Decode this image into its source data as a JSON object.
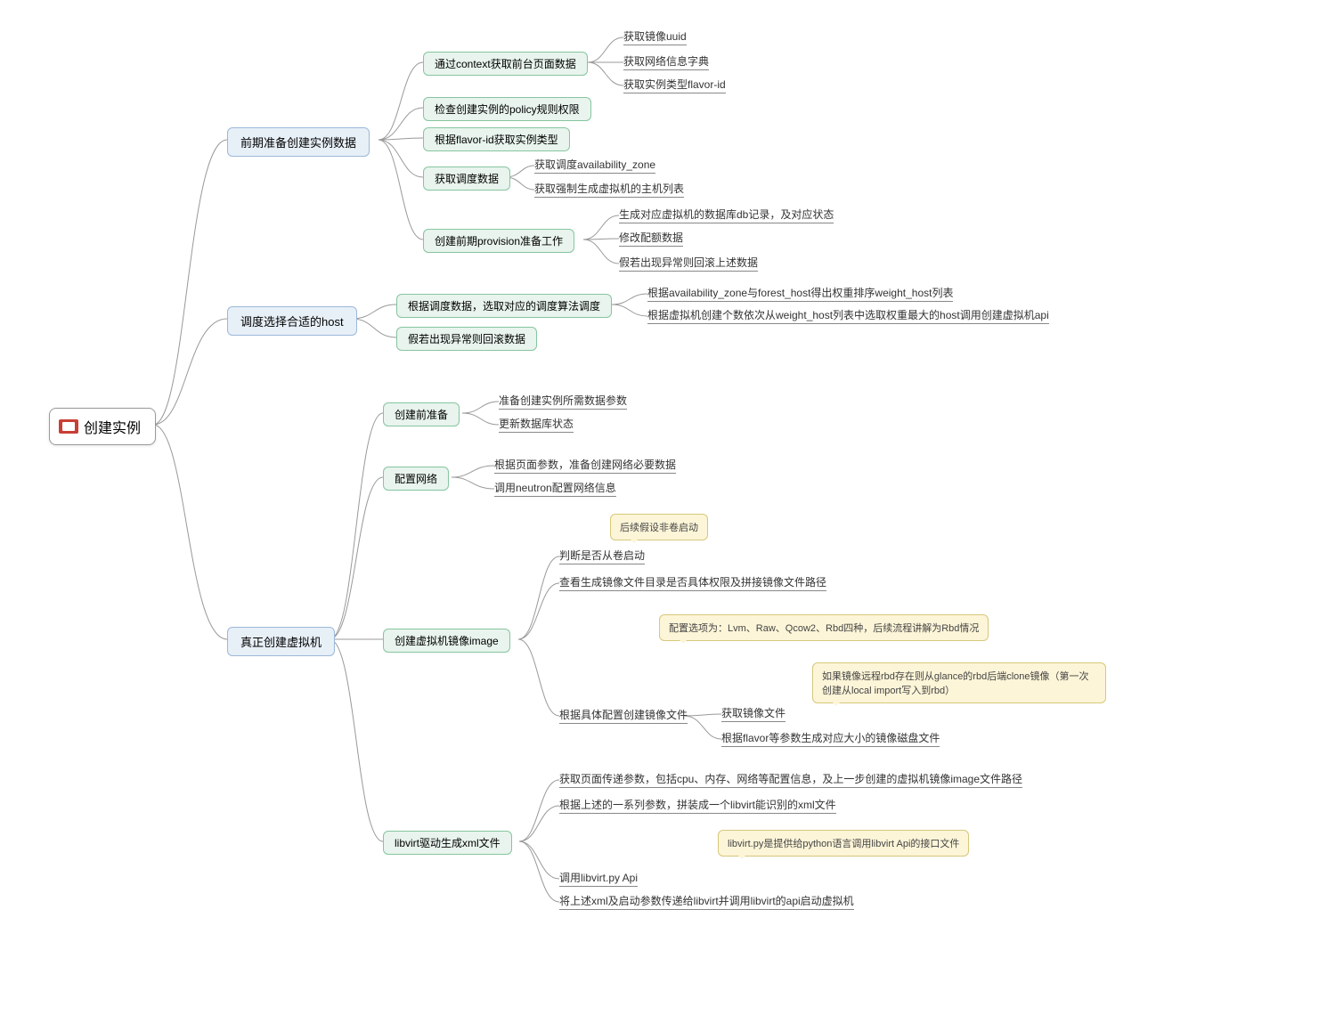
{
  "root": {
    "label": "创建实例"
  },
  "level1": {
    "a": {
      "label": "前期准备创建实例数据"
    },
    "b": {
      "label": "调度选择合适的host"
    },
    "c": {
      "label": "真正创建虚拟机"
    }
  },
  "a": {
    "a1": {
      "label": "通过context获取前台页面数据"
    },
    "a1_c": [
      "获取镜像uuid",
      "获取网络信息字典",
      "获取实例类型flavor-id"
    ],
    "a2": {
      "label": "检查创建实例的policy规则权限"
    },
    "a3": {
      "label": "根据flavor-id获取实例类型"
    },
    "a4": {
      "label": "获取调度数据"
    },
    "a4_c": [
      "获取调度availability_zone",
      "获取强制生成虚拟机的主机列表"
    ],
    "a5": {
      "label": "创建前期provision准备工作"
    },
    "a5_c": [
      "生成对应虚拟机的数据库db记录，及对应状态",
      "修改配额数据",
      "假若出现异常则回滚上述数据"
    ]
  },
  "b": {
    "b1": {
      "label": "根据调度数据，选取对应的调度算法调度"
    },
    "b1_c": [
      "根据availability_zone与forest_host得出权重排序weight_host列表",
      "根据虚拟机创建个数依次从weight_host列表中选取权重最大的host调用创建虚拟机api"
    ],
    "b2": {
      "label": "假若出现异常则回滚数据"
    }
  },
  "c": {
    "c1": {
      "label": "创建前准备"
    },
    "c1_c": [
      "准备创建实例所需数据参数",
      "更新数据库状态"
    ],
    "c2": {
      "label": "配置网络"
    },
    "c2_c": [
      "根据页面参数，准备创建网络必要数据",
      "调用neutron配置网络信息"
    ],
    "c3": {
      "label": "创建虚拟机镜像image"
    },
    "c3_c1": "判断是否从卷启动",
    "c3_c2": "查看生成镜像文件目录是否具体权限及拼接镜像文件路径",
    "c3_c3": "根据具体配置创建镜像文件",
    "c3_c3_c": [
      "获取镜像文件",
      "根据flavor等参数生成对应大小的镜像磁盘文件"
    ],
    "c4": {
      "label": "libvirt驱动生成xml文件"
    },
    "c4_c": [
      "获取页面传递参数，包括cpu、内存、网络等配置信息，及上一步创建的虚拟机镜像image文件路径",
      "根据上述的一系列参数，拼装成一个libvirt能识别的xml文件",
      "调用libvirt.py Api",
      "将上述xml及启动参数传递给libvirt并调用libvirt的api启动虚拟机"
    ]
  },
  "callouts": {
    "co1": "后续假设非卷启动",
    "co2": "配置选项为：Lvm、Raw、Qcow2、Rbd四种，后续流程讲解为Rbd情况",
    "co3": "如果镜像远程rbd存在则从glance的rbd后端clone镜像（第一次创建从local import写入到rbd）",
    "co4": "libvirt.py是提供给python语言调用libvirt Api的接口文件"
  }
}
